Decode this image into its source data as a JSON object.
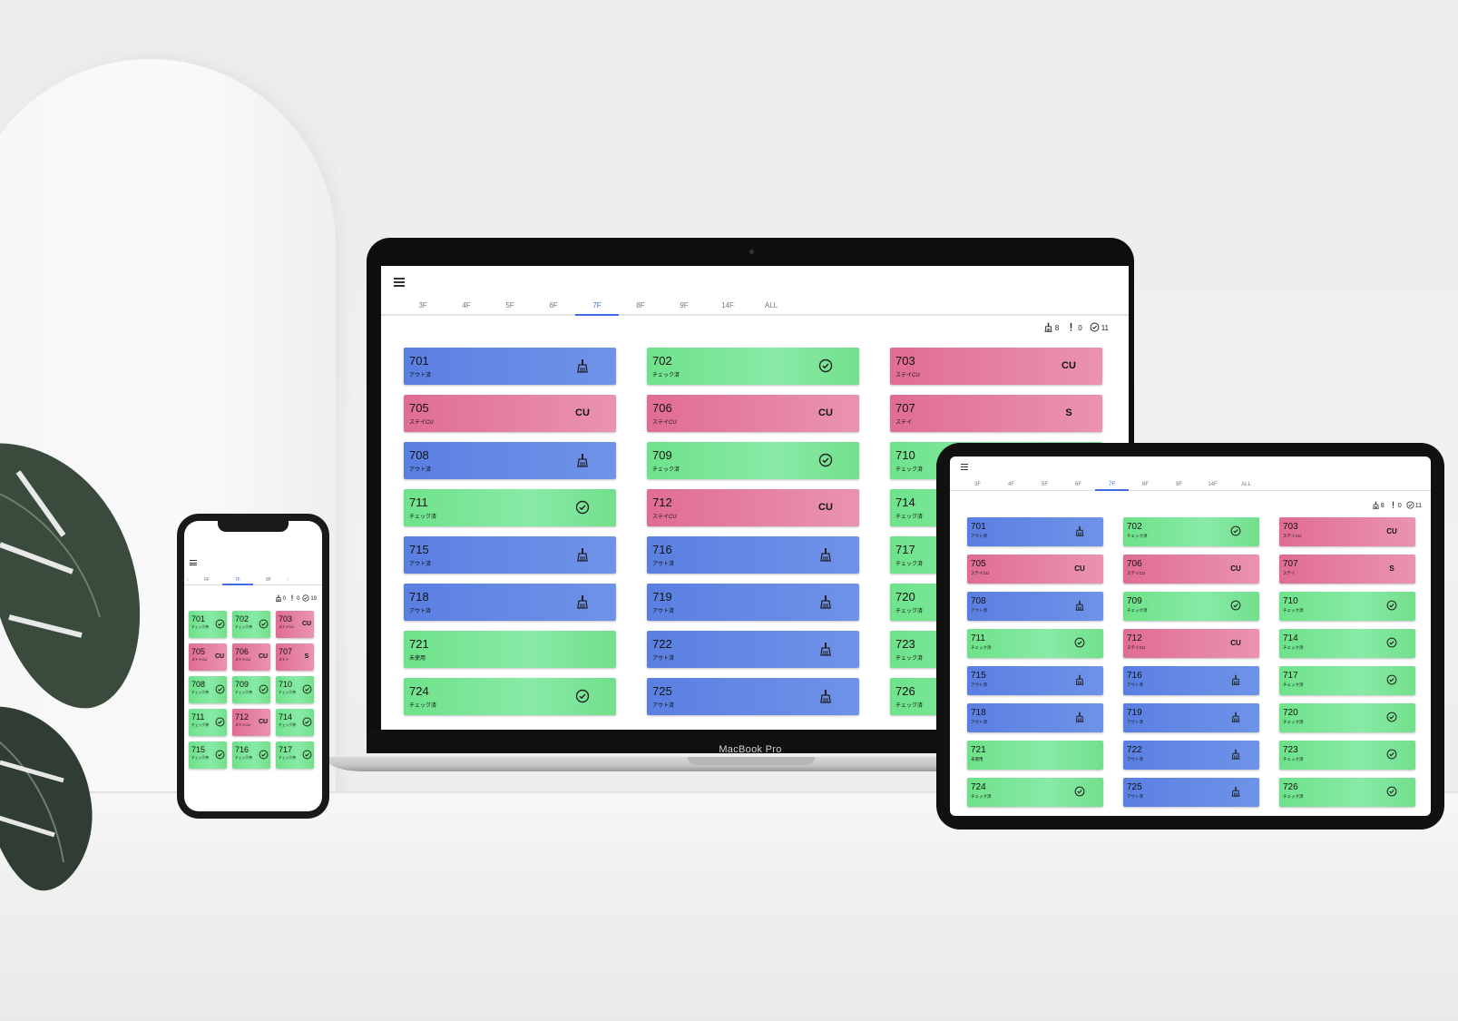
{
  "colors": {
    "blue": "#5a7fe2",
    "green": "#6ee28a",
    "pink": "#e06d91",
    "accent": "#3f6fe0"
  },
  "laptop": {
    "brand": "MacBook Pro",
    "tabs": [
      "3F",
      "4F",
      "5F",
      "6F",
      "7F",
      "8F",
      "9F",
      "14F",
      "ALL"
    ],
    "active_tab": "7F",
    "status": {
      "cleaning": "8",
      "alert": "0",
      "checked": "11"
    },
    "rooms": [
      {
        "num": "701",
        "sub": "アウト済",
        "color": "blue",
        "icon": "broom"
      },
      {
        "num": "702",
        "sub": "チェック済",
        "color": "green",
        "icon": "check"
      },
      {
        "num": "703",
        "sub": "ステイCU",
        "color": "pink",
        "icon": "CU"
      },
      {
        "num": "705",
        "sub": "ステイCU",
        "color": "pink",
        "icon": "CU"
      },
      {
        "num": "706",
        "sub": "ステイCU",
        "color": "pink",
        "icon": "CU"
      },
      {
        "num": "707",
        "sub": "ステイ",
        "color": "pink",
        "icon": "S"
      },
      {
        "num": "708",
        "sub": "アウト済",
        "color": "blue",
        "icon": "broom"
      },
      {
        "num": "709",
        "sub": "チェック済",
        "color": "green",
        "icon": "check"
      },
      {
        "num": "710",
        "sub": "チェック済",
        "color": "green",
        "icon": ""
      },
      {
        "num": "711",
        "sub": "チェック済",
        "color": "green",
        "icon": "check"
      },
      {
        "num": "712",
        "sub": "ステイCU",
        "color": "pink",
        "icon": "CU"
      },
      {
        "num": "714",
        "sub": "チェック済",
        "color": "green",
        "icon": ""
      },
      {
        "num": "715",
        "sub": "アウト済",
        "color": "blue",
        "icon": "broom"
      },
      {
        "num": "716",
        "sub": "アウト済",
        "color": "blue",
        "icon": "broom"
      },
      {
        "num": "717",
        "sub": "チェック済",
        "color": "green",
        "icon": ""
      },
      {
        "num": "718",
        "sub": "アウト済",
        "color": "blue",
        "icon": "broom"
      },
      {
        "num": "719",
        "sub": "アウト済",
        "color": "blue",
        "icon": "broom"
      },
      {
        "num": "720",
        "sub": "チェック済",
        "color": "green",
        "icon": ""
      },
      {
        "num": "721",
        "sub": "未使用",
        "color": "green",
        "icon": ""
      },
      {
        "num": "722",
        "sub": "アウト済",
        "color": "blue",
        "icon": "broom"
      },
      {
        "num": "723",
        "sub": "チェック済",
        "color": "green",
        "icon": ""
      },
      {
        "num": "724",
        "sub": "チェック済",
        "color": "green",
        "icon": "check"
      },
      {
        "num": "725",
        "sub": "アウト済",
        "color": "blue",
        "icon": "broom"
      },
      {
        "num": "726",
        "sub": "チェック済",
        "color": "green",
        "icon": ""
      }
    ]
  },
  "tablet": {
    "tabs": [
      "3F",
      "4F",
      "5F",
      "6F",
      "7F",
      "8F",
      "9F",
      "14F",
      "ALL"
    ],
    "active_tab": "7F",
    "status": {
      "cleaning": "8",
      "alert": "0",
      "checked": "11"
    },
    "rooms": [
      {
        "num": "701",
        "sub": "アウト済",
        "color": "blue",
        "icon": "broom"
      },
      {
        "num": "702",
        "sub": "チェック済",
        "color": "green",
        "icon": "check"
      },
      {
        "num": "703",
        "sub": "ステイCU",
        "color": "pink",
        "icon": "CU"
      },
      {
        "num": "705",
        "sub": "ステイCU",
        "color": "pink",
        "icon": "CU"
      },
      {
        "num": "706",
        "sub": "ステイCU",
        "color": "pink",
        "icon": "CU"
      },
      {
        "num": "707",
        "sub": "ステイ",
        "color": "pink",
        "icon": "S"
      },
      {
        "num": "708",
        "sub": "アウト済",
        "color": "blue",
        "icon": "broom"
      },
      {
        "num": "709",
        "sub": "チェック済",
        "color": "green",
        "icon": "check"
      },
      {
        "num": "710",
        "sub": "チェック済",
        "color": "green",
        "icon": "check"
      },
      {
        "num": "711",
        "sub": "チェック済",
        "color": "green",
        "icon": "check"
      },
      {
        "num": "712",
        "sub": "ステイCU",
        "color": "pink",
        "icon": "CU"
      },
      {
        "num": "714",
        "sub": "チェック済",
        "color": "green",
        "icon": "check"
      },
      {
        "num": "715",
        "sub": "アウト済",
        "color": "blue",
        "icon": "broom"
      },
      {
        "num": "716",
        "sub": "アウト済",
        "color": "blue",
        "icon": "broom"
      },
      {
        "num": "717",
        "sub": "チェック済",
        "color": "green",
        "icon": "check"
      },
      {
        "num": "718",
        "sub": "アウト済",
        "color": "blue",
        "icon": "broom"
      },
      {
        "num": "719",
        "sub": "アウト済",
        "color": "blue",
        "icon": "broom"
      },
      {
        "num": "720",
        "sub": "チェック済",
        "color": "green",
        "icon": "check"
      },
      {
        "num": "721",
        "sub": "未使用",
        "color": "green",
        "icon": ""
      },
      {
        "num": "722",
        "sub": "アウト済",
        "color": "blue",
        "icon": "broom"
      },
      {
        "num": "723",
        "sub": "チェック済",
        "color": "green",
        "icon": "check"
      },
      {
        "num": "724",
        "sub": "チェック済",
        "color": "green",
        "icon": "check"
      },
      {
        "num": "725",
        "sub": "アウト済",
        "color": "blue",
        "icon": "broom"
      },
      {
        "num": "726",
        "sub": "チェック済",
        "color": "green",
        "icon": "check"
      }
    ]
  },
  "phone": {
    "tabs": [
      "6F",
      "7F",
      "8F"
    ],
    "active_tab": "7F",
    "arrow_left": "‹",
    "arrow_right": "›",
    "status": {
      "cleaning": "0",
      "alert": "0",
      "checked": "19"
    },
    "rooms": [
      {
        "num": "701",
        "sub": "チェック済",
        "color": "green",
        "icon": "check"
      },
      {
        "num": "702",
        "sub": "チェック済",
        "color": "green",
        "icon": "check"
      },
      {
        "num": "703",
        "sub": "ステイCU",
        "color": "pink",
        "icon": "CU"
      },
      {
        "num": "705",
        "sub": "ステイCU",
        "color": "pink",
        "icon": "CU"
      },
      {
        "num": "706",
        "sub": "ステイCU",
        "color": "pink",
        "icon": "CU"
      },
      {
        "num": "707",
        "sub": "ステイ",
        "color": "pink",
        "icon": "S"
      },
      {
        "num": "708",
        "sub": "チェック済",
        "color": "green",
        "icon": "check"
      },
      {
        "num": "709",
        "sub": "チェック済",
        "color": "green",
        "icon": "check"
      },
      {
        "num": "710",
        "sub": "チェック済",
        "color": "green",
        "icon": "check"
      },
      {
        "num": "711",
        "sub": "チェック済",
        "color": "green",
        "icon": "check"
      },
      {
        "num": "712",
        "sub": "ステイCU",
        "color": "pink",
        "icon": "CU"
      },
      {
        "num": "714",
        "sub": "チェック済",
        "color": "green",
        "icon": "check"
      },
      {
        "num": "715",
        "sub": "チェック済",
        "color": "green",
        "icon": "check"
      },
      {
        "num": "716",
        "sub": "チェック済",
        "color": "green",
        "icon": "check"
      },
      {
        "num": "717",
        "sub": "チェック済",
        "color": "green",
        "icon": "check"
      }
    ]
  }
}
